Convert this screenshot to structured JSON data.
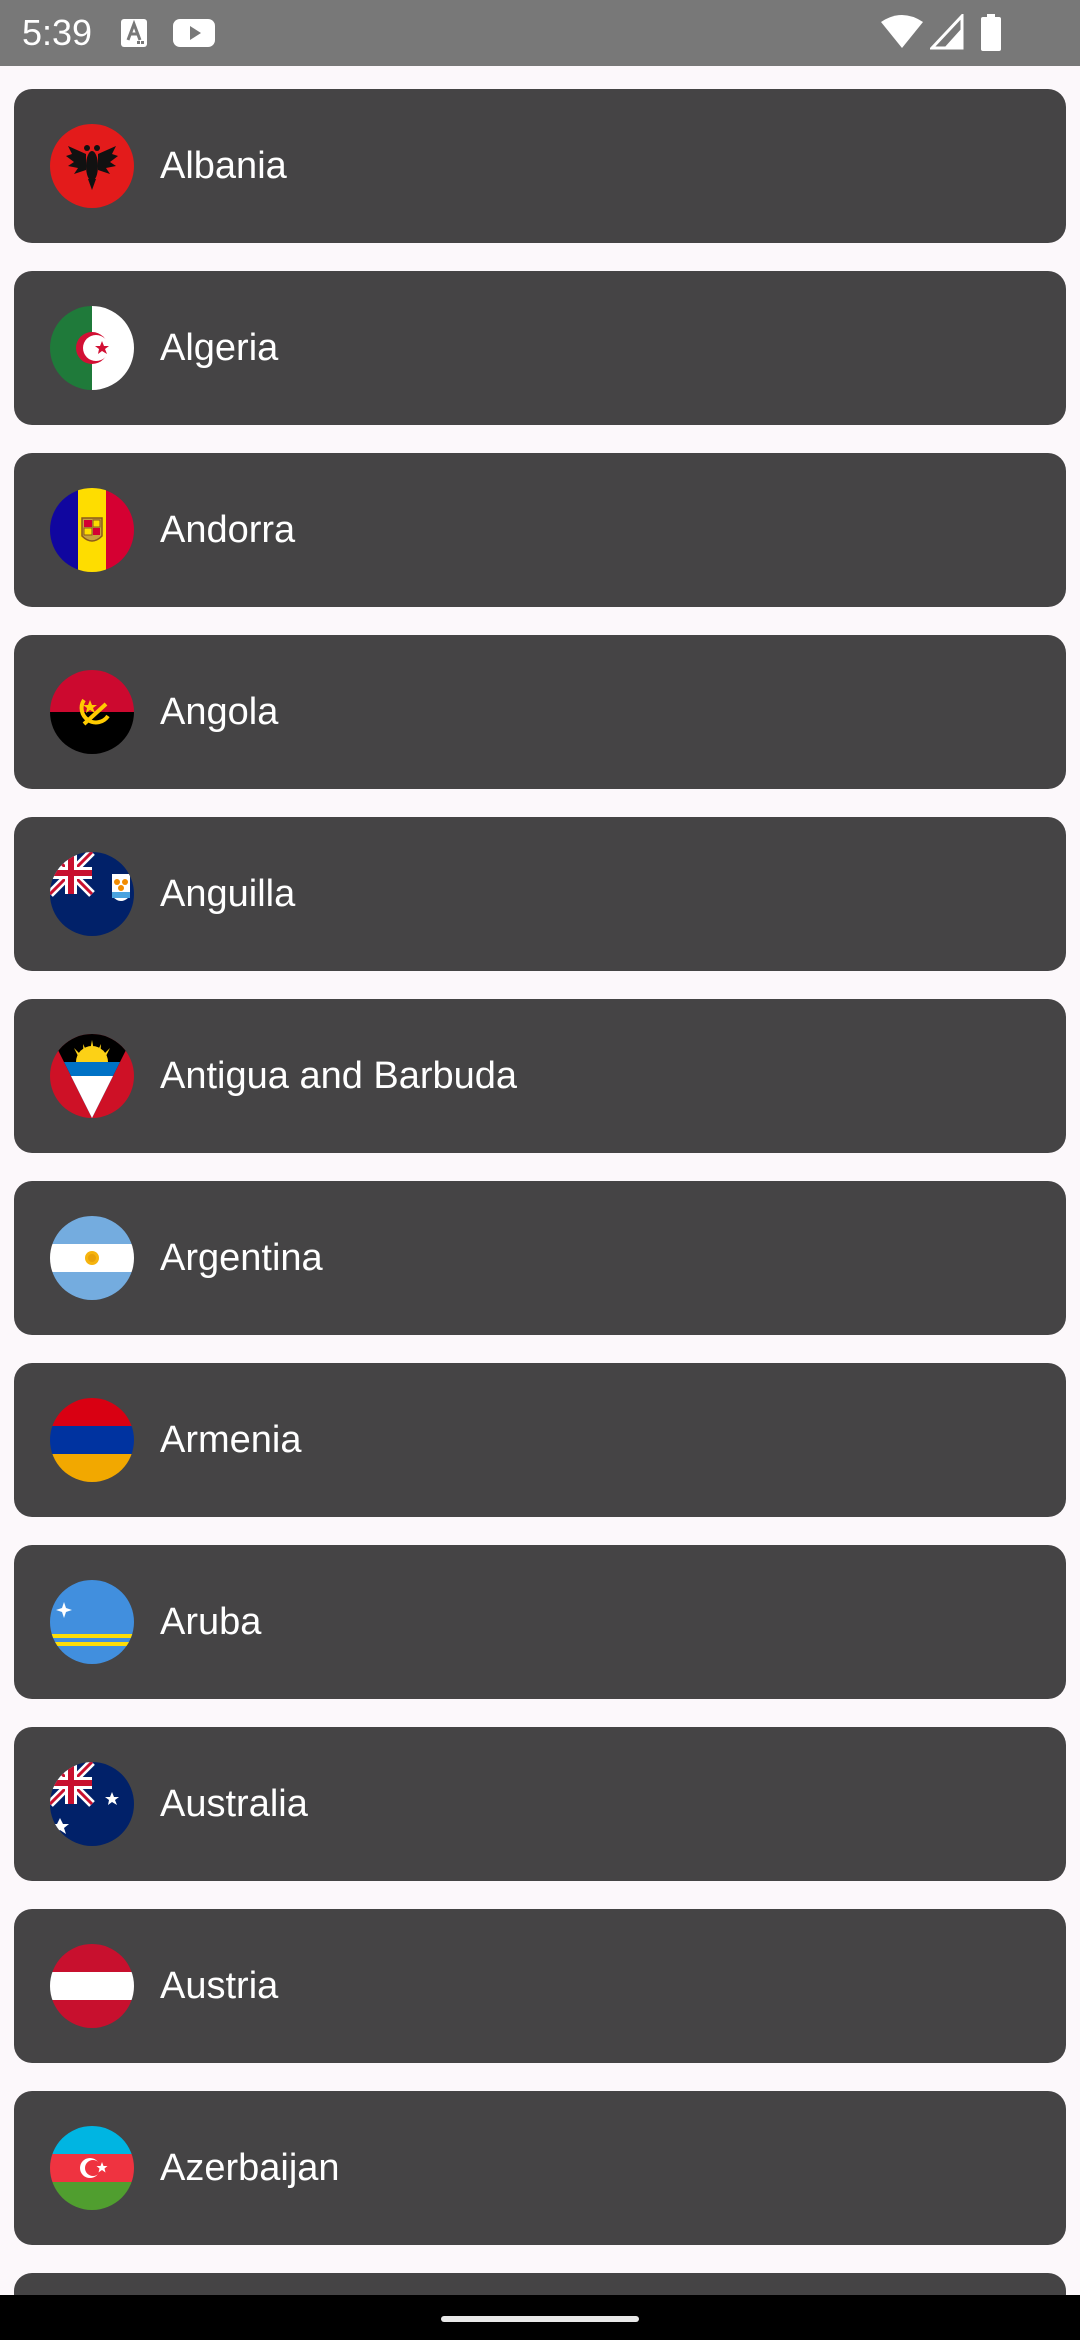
{
  "status_bar": {
    "time": "5:39",
    "icons": [
      "text-notification-icon",
      "youtube-icon",
      "wifi-icon",
      "cellular-signal-icon",
      "battery-icon"
    ]
  },
  "countries": [
    {
      "name": "Albania",
      "flag": "albania-flag-icon"
    },
    {
      "name": "Algeria",
      "flag": "algeria-flag-icon"
    },
    {
      "name": "Andorra",
      "flag": "andorra-flag-icon"
    },
    {
      "name": "Angola",
      "flag": "angola-flag-icon"
    },
    {
      "name": "Anguilla",
      "flag": "anguilla-flag-icon"
    },
    {
      "name": "Antigua and Barbuda",
      "flag": "antigua-and-barbuda-flag-icon"
    },
    {
      "name": "Argentina",
      "flag": "argentina-flag-icon"
    },
    {
      "name": "Armenia",
      "flag": "armenia-flag-icon"
    },
    {
      "name": "Aruba",
      "flag": "aruba-flag-icon"
    },
    {
      "name": "Australia",
      "flag": "australia-flag-icon"
    },
    {
      "name": "Austria",
      "flag": "austria-flag-icon"
    },
    {
      "name": "Azerbaijan",
      "flag": "azerbaijan-flag-icon"
    }
  ],
  "colors": {
    "card_background": "#454445",
    "page_background": "#fcf8fb",
    "status_bar": "#787878",
    "nav_bar": "#000000",
    "text": "#ffffff"
  }
}
